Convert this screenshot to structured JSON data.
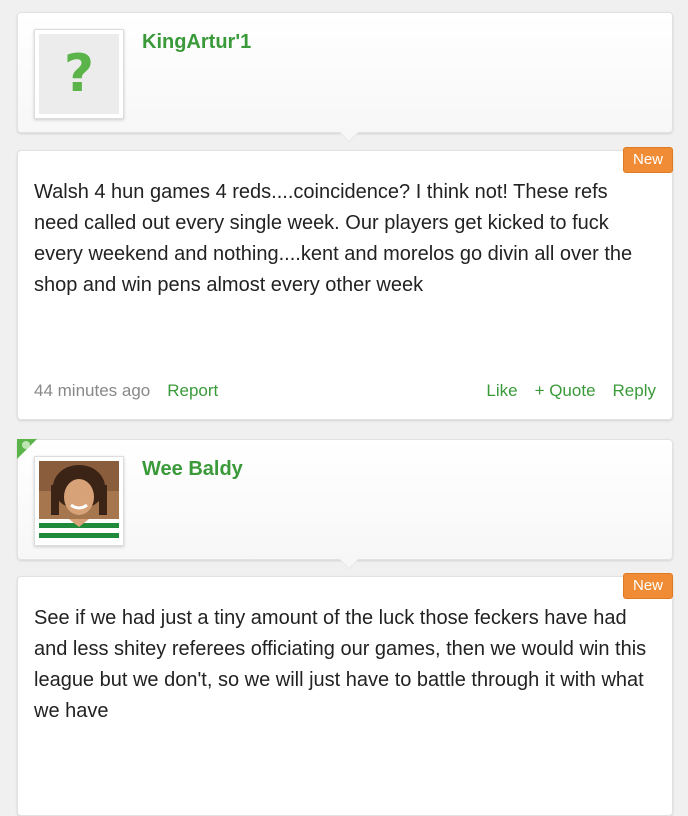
{
  "comments": [
    {
      "username": "KingArtur'1",
      "avatar": "question-mark-placeholder",
      "new_label": "New",
      "text": "Walsh 4 hun games 4 reds....coincidence? I think not! These refs need called out every single week. Our players get kicked to fuck every weekend and nothing....kent and morelos go divin all over the shop and win pens almost every other week",
      "timestamp": "44 minutes ago",
      "report_label": "Report",
      "like_label": "Like",
      "quote_label": "+ Quote",
      "reply_label": "Reply"
    },
    {
      "username": "Wee Baldy",
      "avatar": "player-photo",
      "new_label": "New",
      "text": "See if we had just a tiny amount of the luck those feckers have had and less shitey referees officiating our games, then we would win this league but we don't, so we will just have to battle through it with what we have"
    }
  ],
  "colors": {
    "accent_green": "#3a9a3a",
    "badge_orange": "#f08c35",
    "text": "#222222",
    "muted": "#888888"
  }
}
